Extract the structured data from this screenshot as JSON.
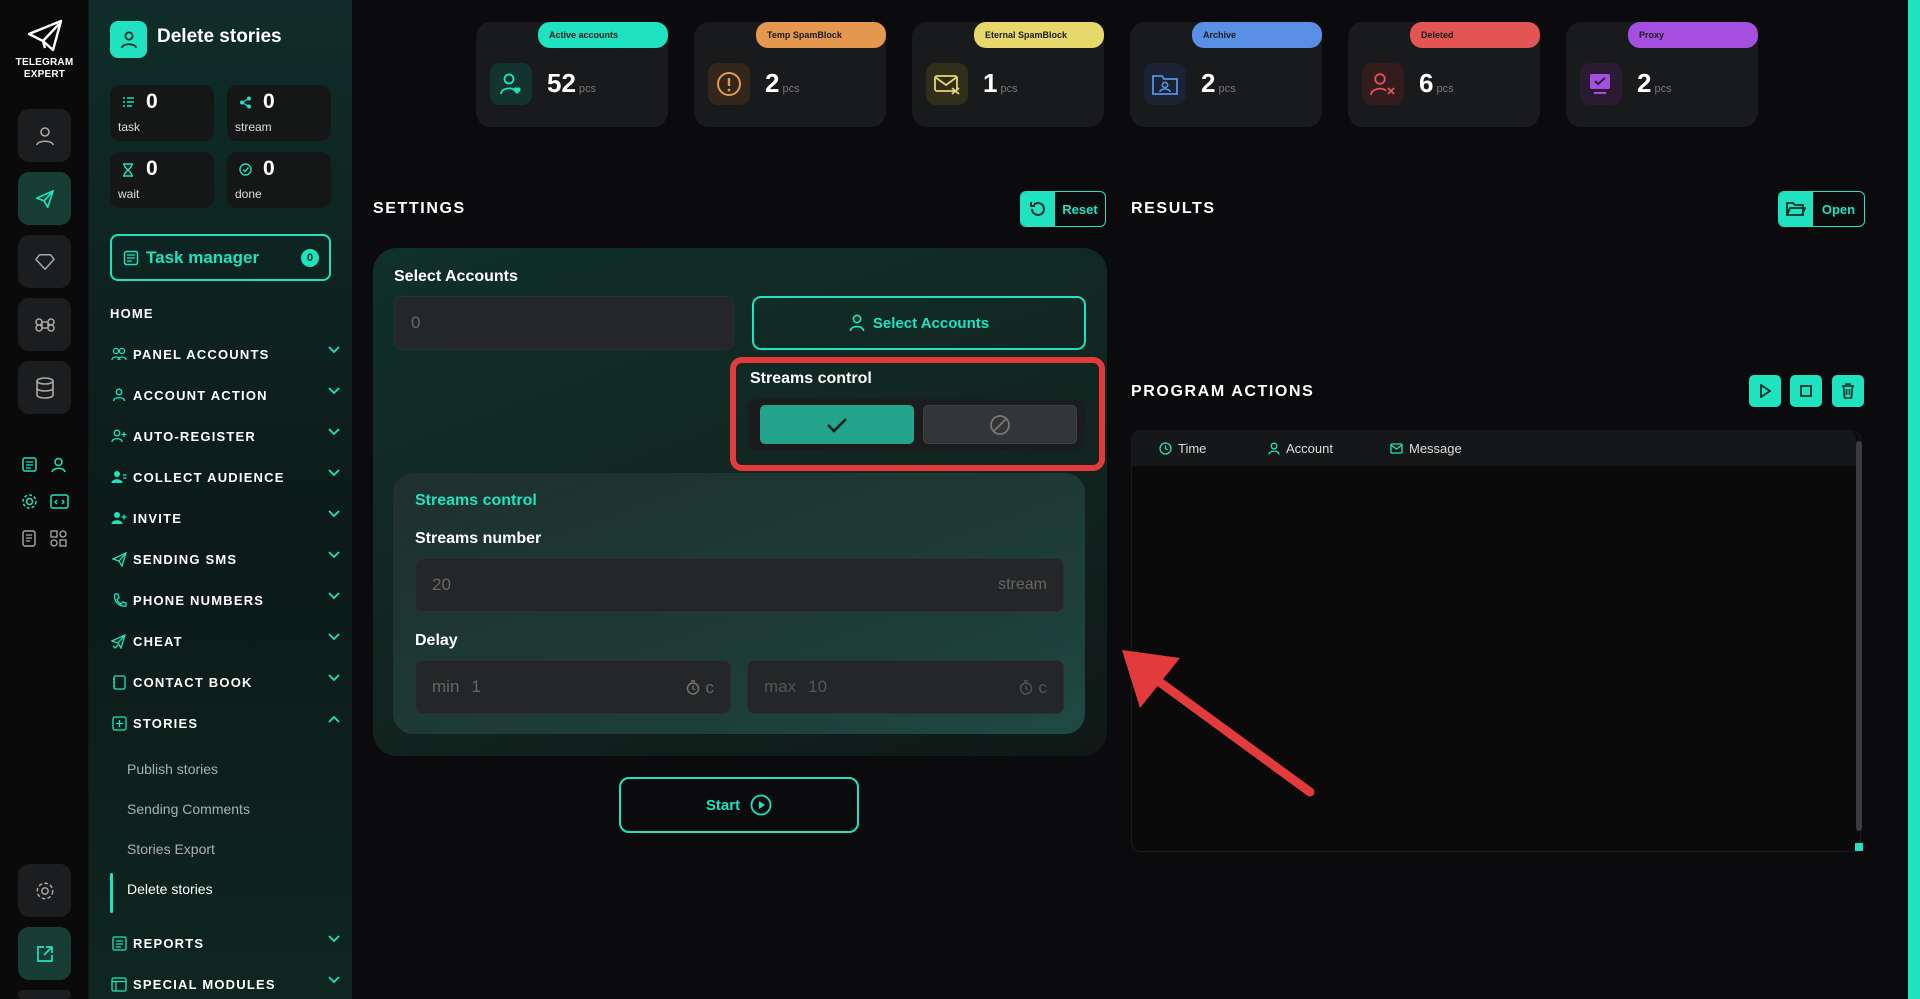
{
  "app": {
    "name_line1": "TELEGRAM",
    "name_line2": "EXPERT",
    "page_title": "Delete stories"
  },
  "stats": [
    {
      "value": "0",
      "label": "task"
    },
    {
      "value": "0",
      "label": "stream"
    },
    {
      "value": "0",
      "label": "wait"
    },
    {
      "value": "0",
      "label": "done"
    }
  ],
  "task_manager": {
    "label": "Task manager",
    "count": "0"
  },
  "nav": {
    "home": "HOME",
    "items": [
      "PANEL ACCOUNTS",
      "ACCOUNT ACTION",
      "AUTO-REGISTER",
      "COLLECT AUDIENCE",
      "INVITE",
      "SENDING SMS",
      "PHONE NUMBERS",
      "CHEAT",
      "CONTACT BOOK",
      "STORIES",
      "REPORTS",
      "SPECIAL MODULES"
    ],
    "stories_sub": [
      "Publish stories",
      "Sending Comments",
      "Stories Export",
      "Delete stories"
    ]
  },
  "counters": [
    {
      "label": "Active accounts",
      "value": "52",
      "unit": "pcs",
      "color": "#1fe3c0"
    },
    {
      "label": "Temp SpamBlock",
      "value": "2",
      "unit": "pcs",
      "color": "#e3974f"
    },
    {
      "label": "Eternal SpamBlock",
      "value": "1",
      "unit": "pcs",
      "color": "#e6d86a"
    },
    {
      "label": "Archive",
      "value": "2",
      "unit": "pcs",
      "color": "#5a8fe6"
    },
    {
      "label": "Deleted",
      "value": "6",
      "unit": "pcs",
      "color": "#e35454"
    },
    {
      "label": "Proxy",
      "value": "2",
      "unit": "pcs",
      "color": "#a44fe0"
    }
  ],
  "settings": {
    "title": "SETTINGS",
    "reset": "Reset",
    "select_accounts_label": "Select Accounts",
    "accounts_value": "0",
    "select_accounts_button": "Select Accounts",
    "streams_control_label": "Streams control",
    "streams_section_title": "Streams control",
    "streams_number_label": "Streams number",
    "streams_number_value": "20",
    "streams_unit": "stream",
    "delay_label": "Delay",
    "delay_min_prefix": "min",
    "delay_min_value": "1",
    "delay_max_prefix": "max",
    "delay_max_value": "10",
    "delay_unit": "c",
    "start": "Start"
  },
  "results": {
    "title": "RESULTS",
    "open": "Open"
  },
  "program_actions": {
    "title": "PROGRAM ACTIONS",
    "columns": [
      "Time",
      "Account",
      "Message"
    ]
  },
  "colors": {
    "accent": "#1fe3c0",
    "highlight": "#e33b3b"
  }
}
